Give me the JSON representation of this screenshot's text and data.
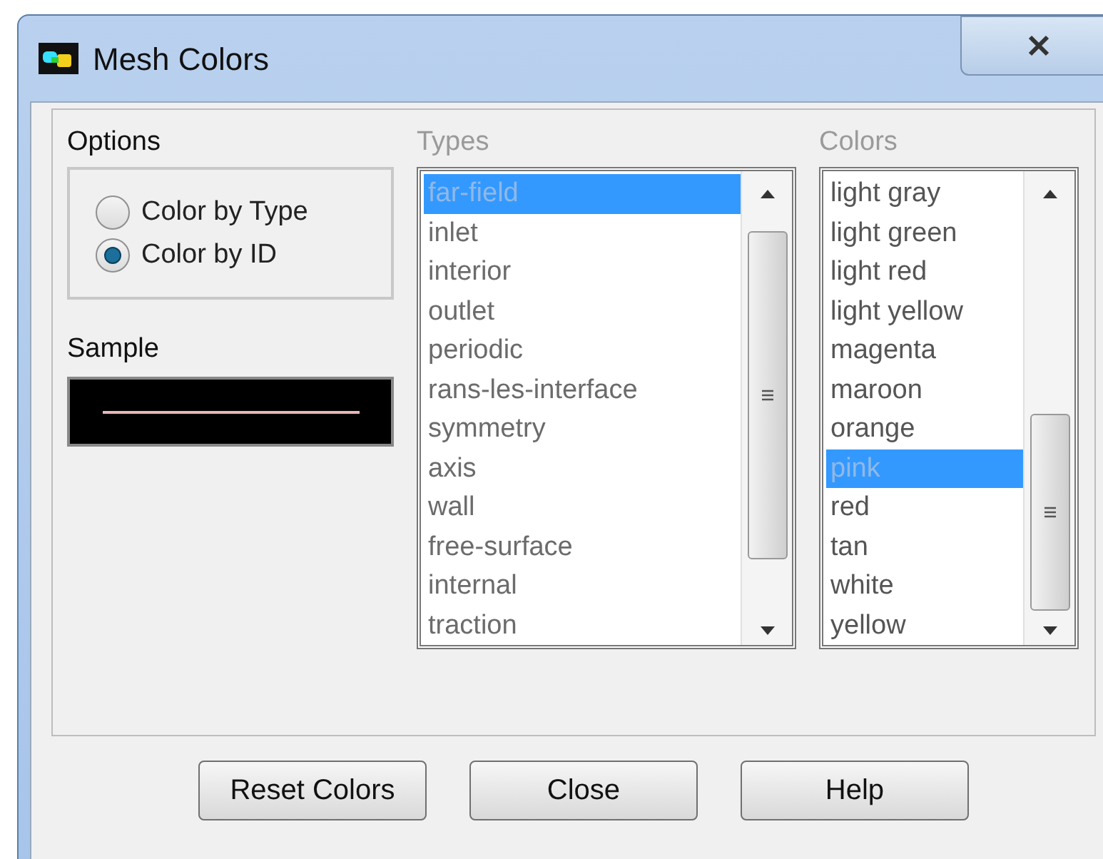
{
  "window": {
    "title": "Mesh Colors"
  },
  "options": {
    "label": "Options",
    "radios": [
      {
        "label": "Color by Type",
        "selected": false
      },
      {
        "label": "Color by ID",
        "selected": true
      }
    ]
  },
  "sample": {
    "label": "Sample"
  },
  "types": {
    "label": "Types",
    "items": [
      {
        "label": "far-field",
        "selected": true
      },
      {
        "label": "inlet",
        "selected": false
      },
      {
        "label": "interior",
        "selected": false
      },
      {
        "label": "outlet",
        "selected": false
      },
      {
        "label": "periodic",
        "selected": false
      },
      {
        "label": "rans-les-interface",
        "selected": false
      },
      {
        "label": "symmetry",
        "selected": false
      },
      {
        "label": "axis",
        "selected": false
      },
      {
        "label": "wall",
        "selected": false
      },
      {
        "label": "free-surface",
        "selected": false
      },
      {
        "label": "internal",
        "selected": false
      },
      {
        "label": "traction",
        "selected": false
      }
    ]
  },
  "colors": {
    "label": "Colors",
    "items": [
      {
        "label": "light gray",
        "selected": false
      },
      {
        "label": "light green",
        "selected": false
      },
      {
        "label": "light red",
        "selected": false
      },
      {
        "label": "light yellow",
        "selected": false
      },
      {
        "label": "magenta",
        "selected": false
      },
      {
        "label": "maroon",
        "selected": false
      },
      {
        "label": "orange",
        "selected": false
      },
      {
        "label": "pink",
        "selected": true
      },
      {
        "label": "red",
        "selected": false
      },
      {
        "label": "tan",
        "selected": false
      },
      {
        "label": "white",
        "selected": false
      },
      {
        "label": "yellow",
        "selected": false
      }
    ]
  },
  "buttons": [
    "Reset Colors",
    "Close",
    "Help"
  ]
}
